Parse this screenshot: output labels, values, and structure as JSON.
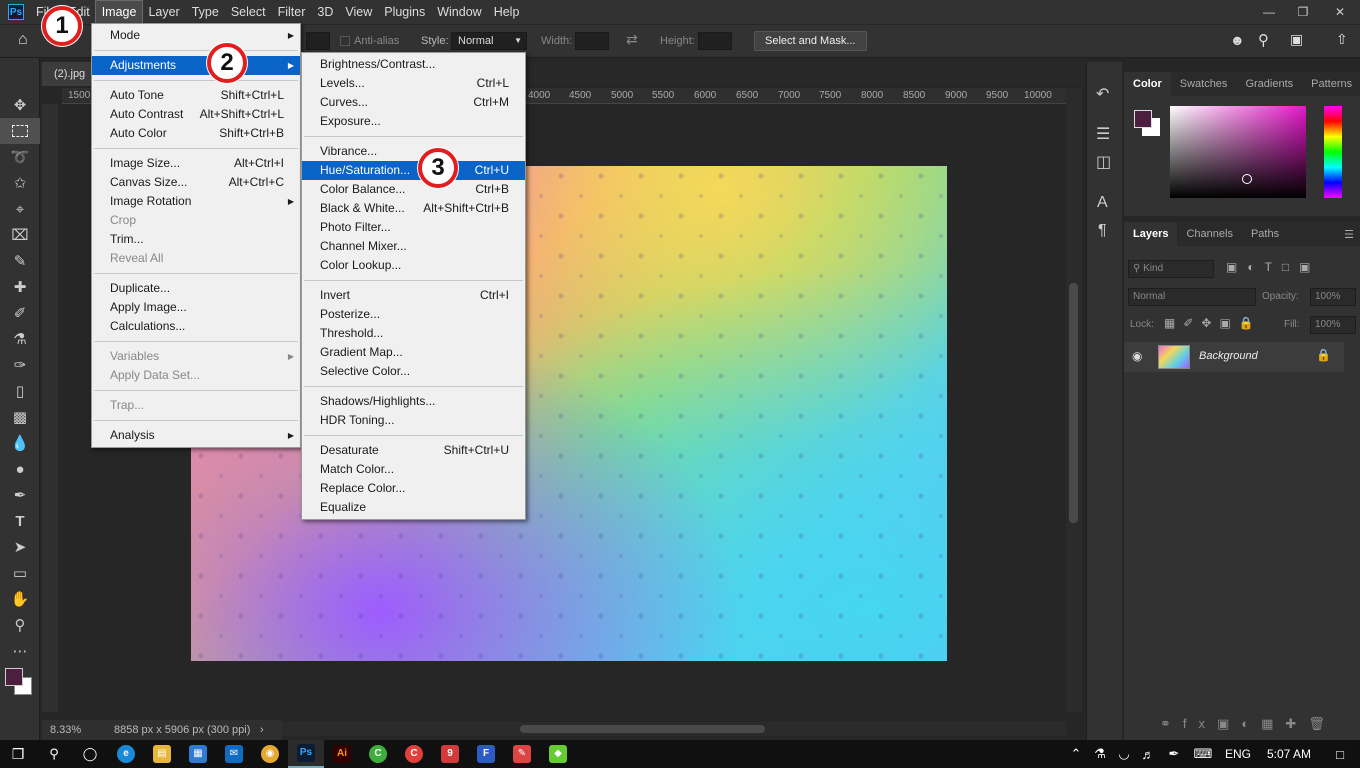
{
  "app": {
    "logo": "Ps"
  },
  "menubar": {
    "items": [
      "File",
      "Edit",
      "Image",
      "Layer",
      "Type",
      "Select",
      "Filter",
      "3D",
      "View",
      "Plugins",
      "Window",
      "Help"
    ],
    "active": "Image"
  },
  "optionsbar": {
    "antialias": "Anti-alias",
    "style_label": "Style:",
    "style_value": "Normal",
    "width_label": "Width:",
    "height_label": "Height:",
    "select_mask": "Select and Mask..."
  },
  "document": {
    "tab": "(2).jpg",
    "zoom": "8.33%",
    "info": "8858 px x 5906 px (300 ppi)"
  },
  "ruler": {
    "ticks": [
      "1500",
      "4000",
      "4500",
      "5000",
      "5500",
      "6000",
      "6500",
      "7000",
      "7500",
      "8000",
      "8500",
      "9000",
      "9500",
      "10000"
    ]
  },
  "image_menu": {
    "rows": [
      {
        "label": "Mode",
        "shortcut": "",
        "arrow": true,
        "state": "normal"
      },
      {
        "sep": true
      },
      {
        "label": "Adjustments",
        "shortcut": "",
        "arrow": true,
        "state": "highlight"
      },
      {
        "sep": true
      },
      {
        "label": "Auto Tone",
        "shortcut": "Shift+Ctrl+L",
        "state": "normal"
      },
      {
        "label": "Auto Contrast",
        "shortcut": "Alt+Shift+Ctrl+L",
        "state": "normal"
      },
      {
        "label": "Auto Color",
        "shortcut": "Shift+Ctrl+B",
        "state": "normal"
      },
      {
        "sep": true
      },
      {
        "label": "Image Size...",
        "shortcut": "Alt+Ctrl+I",
        "state": "normal"
      },
      {
        "label": "Canvas Size...",
        "shortcut": "Alt+Ctrl+C",
        "state": "normal"
      },
      {
        "label": "Image Rotation",
        "shortcut": "",
        "arrow": true,
        "state": "normal"
      },
      {
        "label": "Crop",
        "shortcut": "",
        "state": "disabled"
      },
      {
        "label": "Trim...",
        "shortcut": "",
        "state": "normal"
      },
      {
        "label": "Reveal All",
        "shortcut": "",
        "state": "disabled"
      },
      {
        "sep": true
      },
      {
        "label": "Duplicate...",
        "shortcut": "",
        "state": "normal"
      },
      {
        "label": "Apply Image...",
        "shortcut": "",
        "state": "normal"
      },
      {
        "label": "Calculations...",
        "shortcut": "",
        "state": "normal"
      },
      {
        "sep": true
      },
      {
        "label": "Variables",
        "shortcut": "",
        "arrow": true,
        "state": "disabled"
      },
      {
        "label": "Apply Data Set...",
        "shortcut": "",
        "state": "disabled"
      },
      {
        "sep": true
      },
      {
        "label": "Trap...",
        "shortcut": "",
        "state": "disabled"
      },
      {
        "sep": true
      },
      {
        "label": "Analysis",
        "shortcut": "",
        "arrow": true,
        "state": "normal"
      }
    ]
  },
  "adjust_menu": {
    "rows": [
      {
        "label": "Brightness/Contrast...",
        "shortcut": "",
        "state": "normal"
      },
      {
        "label": "Levels...",
        "shortcut": "Ctrl+L",
        "state": "normal"
      },
      {
        "label": "Curves...",
        "shortcut": "Ctrl+M",
        "state": "normal"
      },
      {
        "label": "Exposure...",
        "shortcut": "",
        "state": "normal"
      },
      {
        "sep": true
      },
      {
        "label": "Vibrance...",
        "shortcut": "",
        "state": "normal"
      },
      {
        "label": "Hue/Saturation...",
        "shortcut": "Ctrl+U",
        "state": "highlight"
      },
      {
        "label": "Color Balance...",
        "shortcut": "Ctrl+B",
        "state": "normal"
      },
      {
        "label": "Black & White...",
        "shortcut": "Alt+Shift+Ctrl+B",
        "state": "normal"
      },
      {
        "label": "Photo Filter...",
        "shortcut": "",
        "state": "normal"
      },
      {
        "label": "Channel Mixer...",
        "shortcut": "",
        "state": "normal"
      },
      {
        "label": "Color Lookup...",
        "shortcut": "",
        "state": "normal"
      },
      {
        "sep": true
      },
      {
        "label": "Invert",
        "shortcut": "Ctrl+I",
        "state": "normal"
      },
      {
        "label": "Posterize...",
        "shortcut": "",
        "state": "normal"
      },
      {
        "label": "Threshold...",
        "shortcut": "",
        "state": "normal"
      },
      {
        "label": "Gradient Map...",
        "shortcut": "",
        "state": "normal"
      },
      {
        "label": "Selective Color...",
        "shortcut": "",
        "state": "normal"
      },
      {
        "sep": true
      },
      {
        "label": "Shadows/Highlights...",
        "shortcut": "",
        "state": "normal"
      },
      {
        "label": "HDR Toning...",
        "shortcut": "",
        "state": "normal"
      },
      {
        "sep": true
      },
      {
        "label": "Desaturate",
        "shortcut": "Shift+Ctrl+U",
        "state": "normal"
      },
      {
        "label": "Match Color...",
        "shortcut": "",
        "state": "normal"
      },
      {
        "label": "Replace Color...",
        "shortcut": "",
        "state": "normal"
      },
      {
        "label": "Equalize",
        "shortcut": "",
        "state": "normal"
      }
    ]
  },
  "callouts": [
    "1",
    "2",
    "3"
  ],
  "color_panel": {
    "tabs": [
      "Color",
      "Swatches",
      "Gradients",
      "Patterns"
    ],
    "foreground": "#4a1f3f"
  },
  "layers_panel": {
    "tabs": [
      "Layers",
      "Channels",
      "Paths"
    ],
    "kind": "Kind",
    "blend": "Normal",
    "opacity_label": "Opacity:",
    "opacity": "100%",
    "lock_label": "Lock:",
    "fill_label": "Fill:",
    "fill": "100%",
    "layer_name": "Background"
  },
  "taskbar": {
    "lang": "ENG",
    "time": "5:07 AM"
  },
  "colors": {
    "accent": "#0a64c8",
    "callout_border": "#e01e1e"
  }
}
